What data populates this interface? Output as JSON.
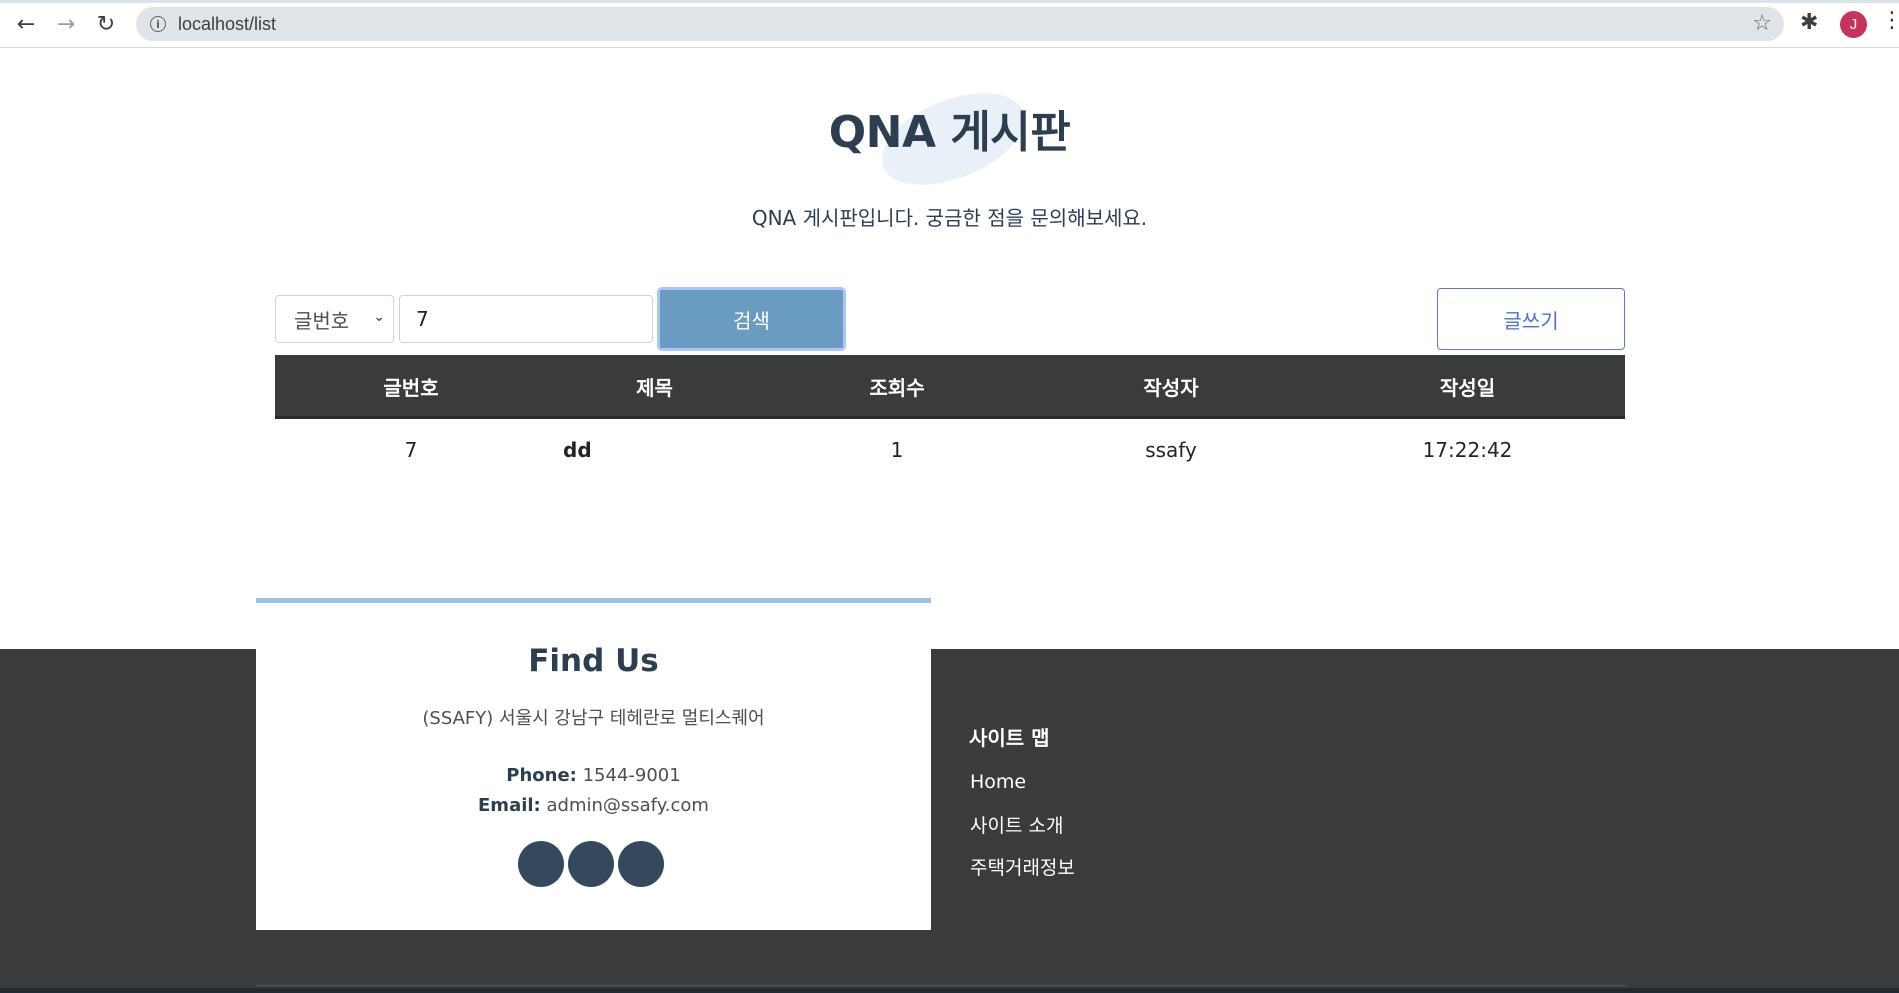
{
  "browser": {
    "url": "localhost/list",
    "back_icon": "arrow-left-icon",
    "forward_icon": "arrow-right-icon",
    "reload_icon": "reload-icon",
    "avatar_letter": "J",
    "avatar_color": "#c7335a"
  },
  "header": {
    "title": "QNA 게시판",
    "subtitle": "QNA 게시판입니다. 궁금한 점을 문의해보세요."
  },
  "search": {
    "select_value": "글번호",
    "input_value": "7",
    "search_label": "검색",
    "write_label": "글쓰기"
  },
  "table": {
    "columns": [
      "글번호",
      "제목",
      "조회수",
      "작성자",
      "작성일"
    ],
    "rows": [
      [
        "7",
        "dd",
        "1",
        "ssafy",
        "17:22:42"
      ]
    ]
  },
  "footer": {
    "findus_title": "Find Us",
    "address": "(SSAFY) 서울시 강남구 테헤란로 멀티스퀘어",
    "phone_label": "Phone:",
    "phone_value": "1544-9001",
    "email_label": "Email:",
    "email_value": "admin@ssafy.com",
    "sitemap_title": "사이트 맵",
    "sitemap_links": [
      "Home",
      "사이트 소개",
      "주택거래정보"
    ]
  },
  "colors": {
    "primary_text": "#2c3e50",
    "search_button": "#6a9bc3",
    "write_button_border": "#5b79d6",
    "table_header": "#3a3b3d",
    "footer_bg": "#3a3b3c",
    "accent": "#9fc0de"
  }
}
